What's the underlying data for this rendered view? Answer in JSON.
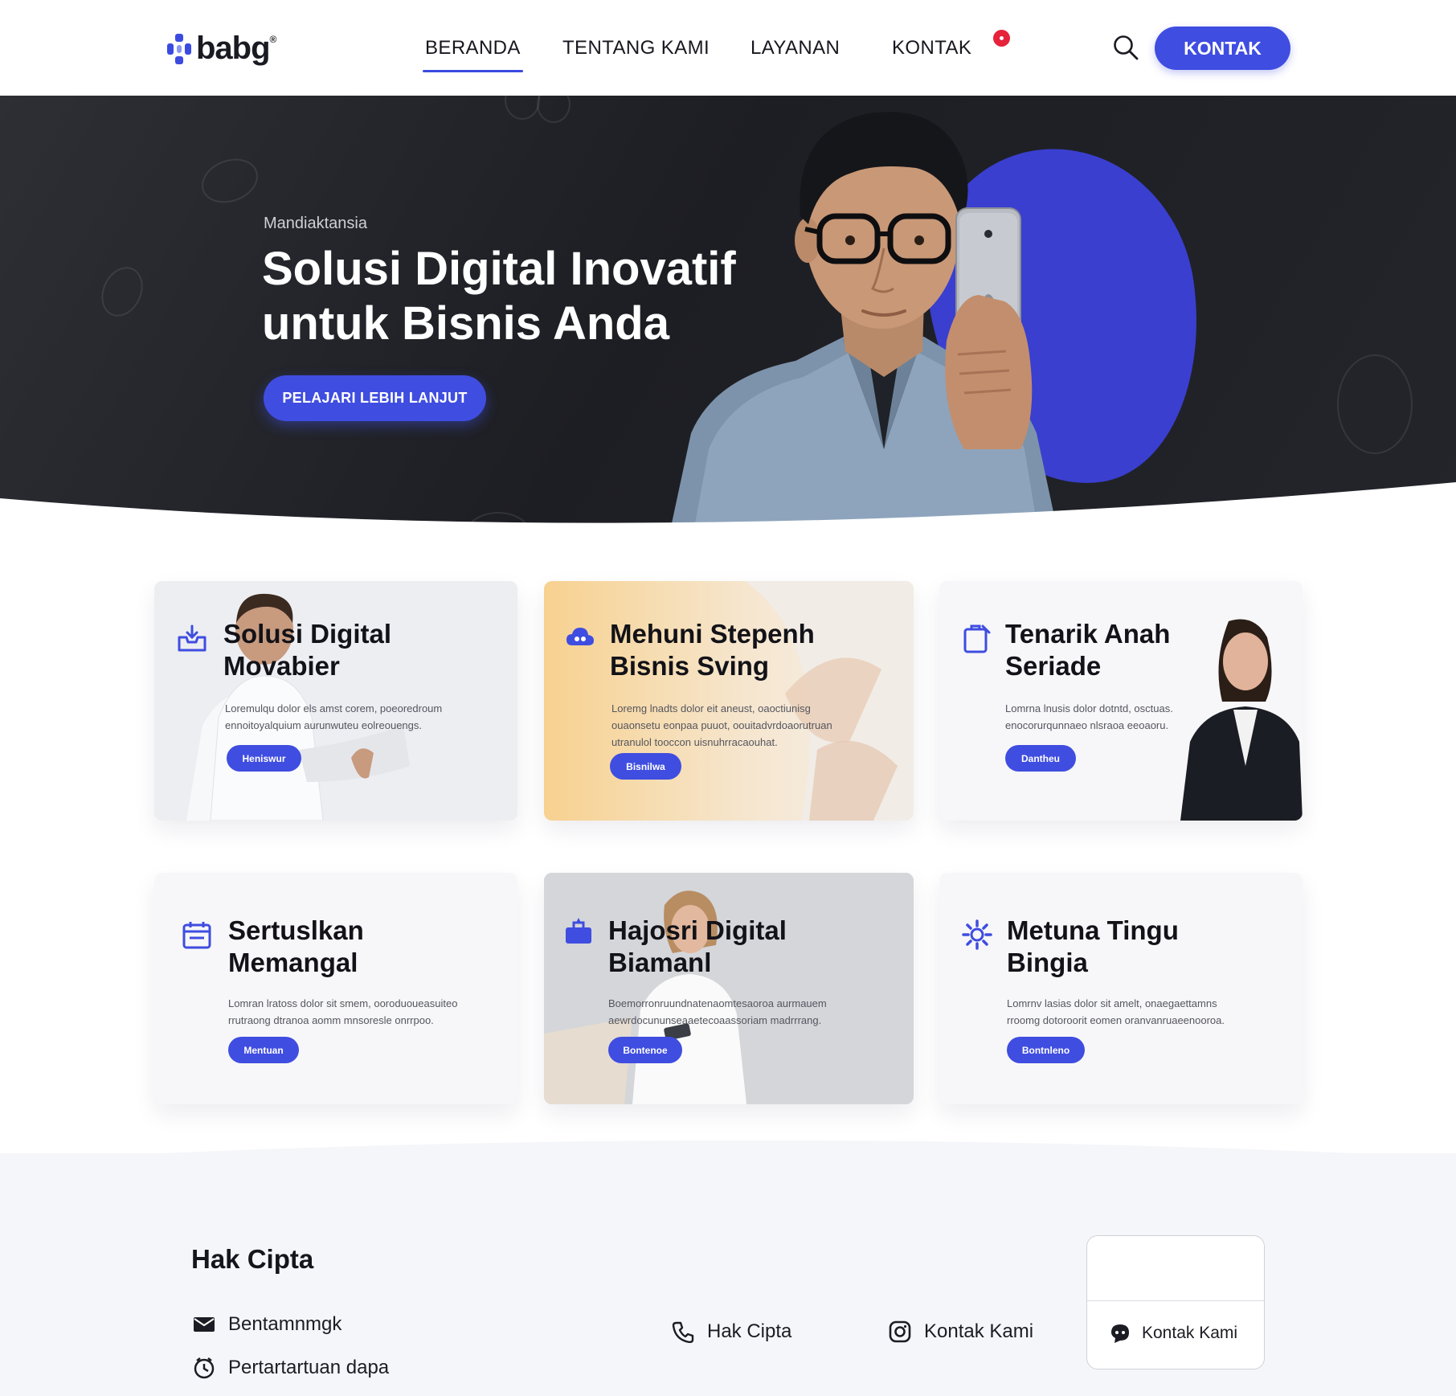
{
  "brand": {
    "name": "babg",
    "mark": "®",
    "accent": "#3f4de0"
  },
  "nav": {
    "items": [
      {
        "label": "BERANDA",
        "active": true
      },
      {
        "label": "TENTANG KAMI",
        "active": false
      },
      {
        "label": "LAYANAN",
        "active": false
      },
      {
        "label": "KONTAK",
        "active": false
      }
    ],
    "cta": "KONTAK",
    "icons": {
      "search": "search-icon",
      "badge": "notification-badge"
    }
  },
  "hero": {
    "kicker": "Mandiaktansia",
    "title_line1": "Solusi Digital Inovatif",
    "title_line2": "untuk Bisnis Anda",
    "cta": "PELAJARI LEBIH LANJUT",
    "blob_color": "#3a3fcf"
  },
  "cards": [
    {
      "title_line1": "Solusi Digital",
      "title_line2": "Movabier",
      "desc": "Loremulqu dolor els amst corem, poeoredroum ennoitoyalquium aurunwuteu eolreouengs.",
      "button": "Heniswur",
      "icon": "inbox-icon"
    },
    {
      "title_line1": "Mehuni Stepenh",
      "title_line2": "Bisnis Sving",
      "desc": "Loremg lnadts dolor eit aneust, oaoctiunisg ouaonsetu eonpaa puuot, oouitadvrdoaorutruan utranulol tooccon uisnuhrracaouhat.",
      "button": "Bisnilwa",
      "icon": "cloud-icon"
    },
    {
      "title_line1": "Tenarik Anah",
      "title_line2": "Seriade",
      "desc": "Lomrna lnusis dolor dotntd, osctuas. enocorurqunnaeo nlsraoa eeoaoru.",
      "button": "Dantheu",
      "icon": "clipboard-icon"
    },
    {
      "title_line1": "Sertuslkan",
      "title_line2": "Memangal",
      "desc": "Lomran lratoss dolor sit smem, ooroduoueasuiteo rrutraong dtranoa aomm mnsoresle onrrpoo.",
      "button": "Mentuan",
      "icon": "calendar-icon"
    },
    {
      "title_line1": "Hajosri Digital",
      "title_line2": "Biamanl",
      "desc": "Boemorronruundnatenaomtesaoroa aurmauem aewrdocununseaaetecoaassoriam madrrrang.",
      "button": "Bontenoe",
      "icon": "briefcase-icon"
    },
    {
      "title_line1": "Metuna Tingu",
      "title_line2": "Bingia",
      "desc": "Lomrnv lasias dolor sit amelt, onaegaettamns rroomg dotoroorit eomen oranvanruaeenooroa.",
      "button": "Bontnleno",
      "icon": "gear-icon"
    }
  ],
  "footer": {
    "title": "Hak Cipta",
    "left_items": [
      {
        "label": "Bentamnmgk",
        "icon": "mail-icon"
      },
      {
        "label": "Pertartartuan dapa",
        "icon": "clock-icon"
      }
    ],
    "phone": {
      "label": "Hak Cipta",
      "icon": "phone-icon"
    },
    "instagram": {
      "label": "Kontak Kami",
      "icon": "instagram-icon"
    },
    "box": {
      "label": "Kontak Kami",
      "icon": "chat-icon"
    }
  }
}
